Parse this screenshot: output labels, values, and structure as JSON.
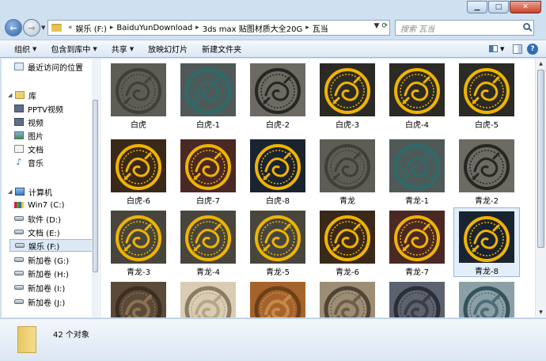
{
  "window": {
    "controls": {
      "minimize": "▁",
      "maximize": "□",
      "close": "✕"
    }
  },
  "address": {
    "overflow": "«",
    "crumbs": [
      "娱乐 (F:)",
      "BaiduYunDownload",
      "3ds max 贴图材质大全20G",
      "瓦当"
    ],
    "search_placeholder": "搜索 瓦当"
  },
  "toolbar": {
    "organize": "组织",
    "include_library": "包含到库中",
    "share": "共享",
    "slideshow": "放映幻灯片",
    "new_folder": "新建文件夹"
  },
  "nav": {
    "recent": "最近访问的位置",
    "libraries": "库",
    "pptv": "PPTV视频",
    "videos": "视频",
    "pictures": "图片",
    "documents": "文档",
    "music": "音乐",
    "computer": "计算机",
    "drives": [
      "Win7 (C:)",
      "软件 (D:)",
      "文档 (E:)",
      "娱乐 (F:)",
      "新加卷 (G:)",
      "新加卷 (H:)",
      "新加卷 (I:)",
      "新加卷 (J:)"
    ]
  },
  "files": [
    {
      "name": "白虎",
      "style": "gray"
    },
    {
      "name": "白虎-1",
      "style": "teal"
    },
    {
      "name": "白虎-2",
      "style": "dark"
    },
    {
      "name": "白虎-3",
      "style": "gold-black"
    },
    {
      "name": "白虎-4",
      "style": "gold-black"
    },
    {
      "name": "白虎-5",
      "style": "gold-black"
    },
    {
      "name": "白虎-6",
      "style": "gold-brown"
    },
    {
      "name": "白虎-7",
      "style": "gold-maroon"
    },
    {
      "name": "白虎-8",
      "style": "gold-navy"
    },
    {
      "name": "青龙",
      "style": "gray"
    },
    {
      "name": "青龙-1",
      "style": "teal"
    },
    {
      "name": "青龙-2",
      "style": "dark"
    },
    {
      "name": "青龙-3",
      "style": "gold-olive"
    },
    {
      "name": "青龙-4",
      "style": "gold-olive"
    },
    {
      "name": "青龙-5",
      "style": "gold-olive"
    },
    {
      "name": "青龙-6",
      "style": "gold-brown"
    },
    {
      "name": "青龙-7",
      "style": "gold-maroon"
    },
    {
      "name": "青龙-8",
      "style": "gold-navy"
    },
    {
      "name": "",
      "style": "stone-brown"
    },
    {
      "name": "",
      "style": "stone-cream"
    },
    {
      "name": "",
      "style": "stone-orange"
    },
    {
      "name": "",
      "style": "stone-tan"
    },
    {
      "name": "",
      "style": "stone-slate"
    },
    {
      "name": "",
      "style": "stone-teal"
    }
  ],
  "status": {
    "count_text": "42 个对象"
  },
  "colors": {
    "selection": "#e3eefb",
    "accent": "#2d62a8",
    "gold": "#f0b400"
  }
}
